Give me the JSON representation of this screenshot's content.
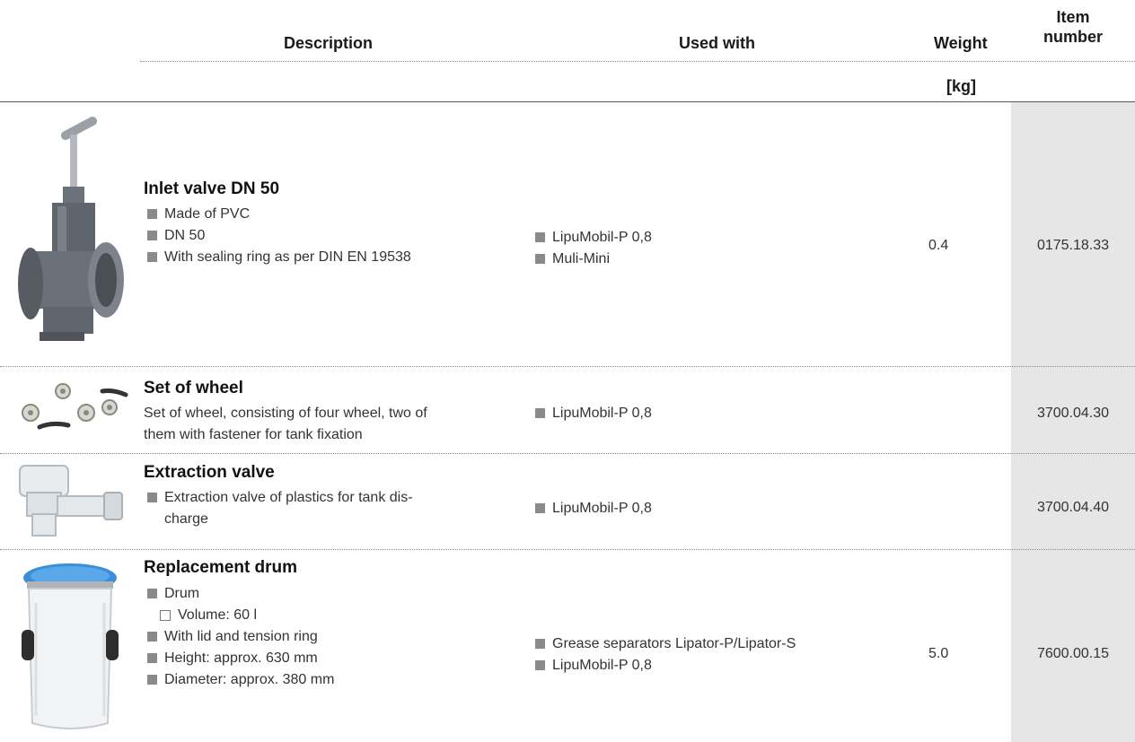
{
  "header": {
    "description": "Description",
    "used_with": "Used with",
    "weight": "Weight",
    "item_number_line1": "Item",
    "item_number_line2": "number",
    "weight_unit": "[kg]"
  },
  "rows": [
    {
      "title": "Inlet valve DN 50",
      "bullets": [
        "Made of PVC",
        "DN 50",
        "With sealing ring as per DIN EN 19538"
      ],
      "used_with": [
        "LipuMobil-P 0,8",
        "Muli-Mini"
      ],
      "weight": "0.4",
      "item_number": "0175.18.33",
      "icon": "gate-valve-icon"
    },
    {
      "title": "Set of wheel",
      "text_line1": "Set of wheel, consisting of four wheel, two of",
      "text_line2": "them with fastener for tank fixation",
      "used_with": [
        "LipuMobil-P 0,8"
      ],
      "weight": "",
      "item_number": "3700.04.30",
      "icon": "wheels-icon"
    },
    {
      "title": "Extraction valve",
      "bullet_line1": "Extraction valve of plastics for tank dis-",
      "bullet_line2": "charge",
      "used_with": [
        "LipuMobil-P 0,8"
      ],
      "weight": "",
      "item_number": "3700.04.40",
      "icon": "tap-valve-icon"
    },
    {
      "title": "Replacement drum",
      "bullets": [
        "Drum",
        "Volume: 60 l",
        "With lid and tension ring",
        "Height: approx. 630 mm",
        "Diameter: approx. 380 mm"
      ],
      "used_with": [
        "Grease separators Lipator-P/Lipator-S",
        "LipuMobil-P 0,8"
      ],
      "weight": "5.0",
      "item_number": "7600.00.15",
      "icon": "drum-icon"
    }
  ]
}
